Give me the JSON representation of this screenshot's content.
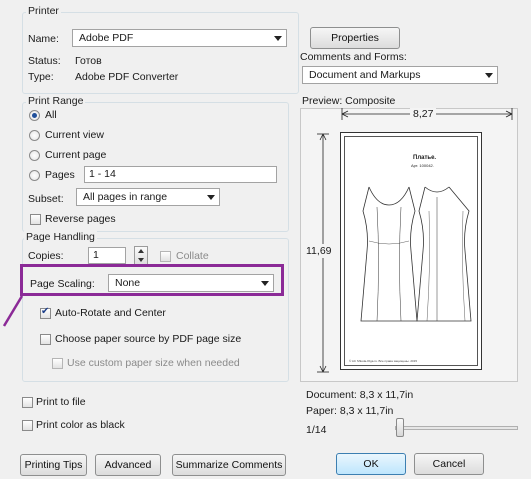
{
  "printer": {
    "legend": "Printer",
    "name_label": "Name:",
    "name_value": "Adobe PDF",
    "status_label": "Status:",
    "status_value": "Готов",
    "type_label": "Type:",
    "type_value": "Adobe PDF Converter",
    "properties_button": "Properties",
    "comments_label": "Comments and Forms:",
    "comments_value": "Document and Markups"
  },
  "print_range": {
    "legend": "Print Range",
    "all": "All",
    "current_view": "Current view",
    "current_page": "Current page",
    "pages": "Pages",
    "pages_value": "1 - 14",
    "subset_label": "Subset:",
    "subset_value": "All pages in range",
    "reverse_pages": "Reverse pages"
  },
  "page_handling": {
    "legend": "Page Handling",
    "copies_label": "Copies:",
    "copies_value": "1",
    "collate": "Collate",
    "scaling_label": "Page Scaling:",
    "scaling_value": "None",
    "auto_rotate": "Auto-Rotate and Center",
    "paper_source": "Choose paper source by PDF page size",
    "custom_paper": "Use custom paper size when needed"
  },
  "options": {
    "print_to_file": "Print to file",
    "print_color_black": "Print color as black"
  },
  "preview": {
    "label": "Preview: Composite",
    "width_value": "8,27",
    "height_value": "11,69",
    "page_title": "Платье.",
    "page_subtitle": "Арт. 100042.",
    "footer_text": "© AC Shkola-Olga.ru. Все права защищены. 2015",
    "document_size": "Document: 8,3 x 11,7in",
    "paper_size": "Paper: 8,3 x 11,7in",
    "page_counter": "1/14",
    "slider_position": 0.0
  },
  "buttons": {
    "printing_tips": "Printing Tips",
    "advanced": "Advanced",
    "summarize_comments": "Summarize Comments",
    "ok": "OK",
    "cancel": "Cancel"
  },
  "colors": {
    "highlight": "#8b2a97",
    "accent": "#3c7fb1"
  }
}
